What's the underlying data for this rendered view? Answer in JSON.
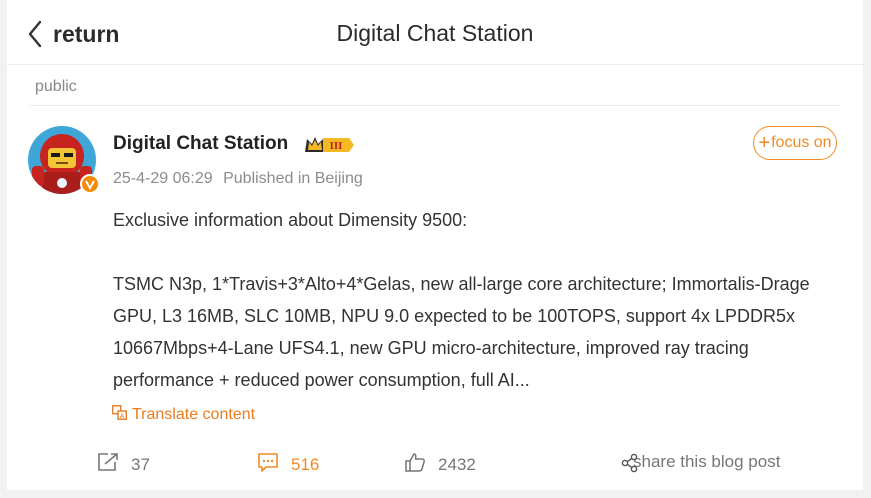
{
  "header": {
    "back_label": "return",
    "title": "Digital Chat Station"
  },
  "visibility": "public",
  "post": {
    "author": "Digital Chat Station",
    "badge_text": "III",
    "timestamp": "25-4-29 06:29",
    "location": "Published in Beijing",
    "follow_label": "focus on",
    "paragraphs": [
      "Exclusive information about Dimensity 9500:",
      "TSMC N3p, 1*Travis+3*Alto+4*Gelas, new all-large core architecture; Immortalis-Drage GPU, L3 16MB, SLC 10MB, NPU 9.0 expected to be 100TOPS, support 4x LPDDR5x 10667Mbps+4-Lane UFS4.1, new GPU micro-architecture, improved ray tracing performance + reduced power consumption, full AI..."
    ],
    "translate_label": "Translate content"
  },
  "actions": {
    "repost_count": "37",
    "comment_count": "516",
    "like_count": "2432",
    "share_label": "share this blog post"
  },
  "colors": {
    "accent": "#f08a24",
    "text": "#333333",
    "muted": "#8b8b8b"
  }
}
